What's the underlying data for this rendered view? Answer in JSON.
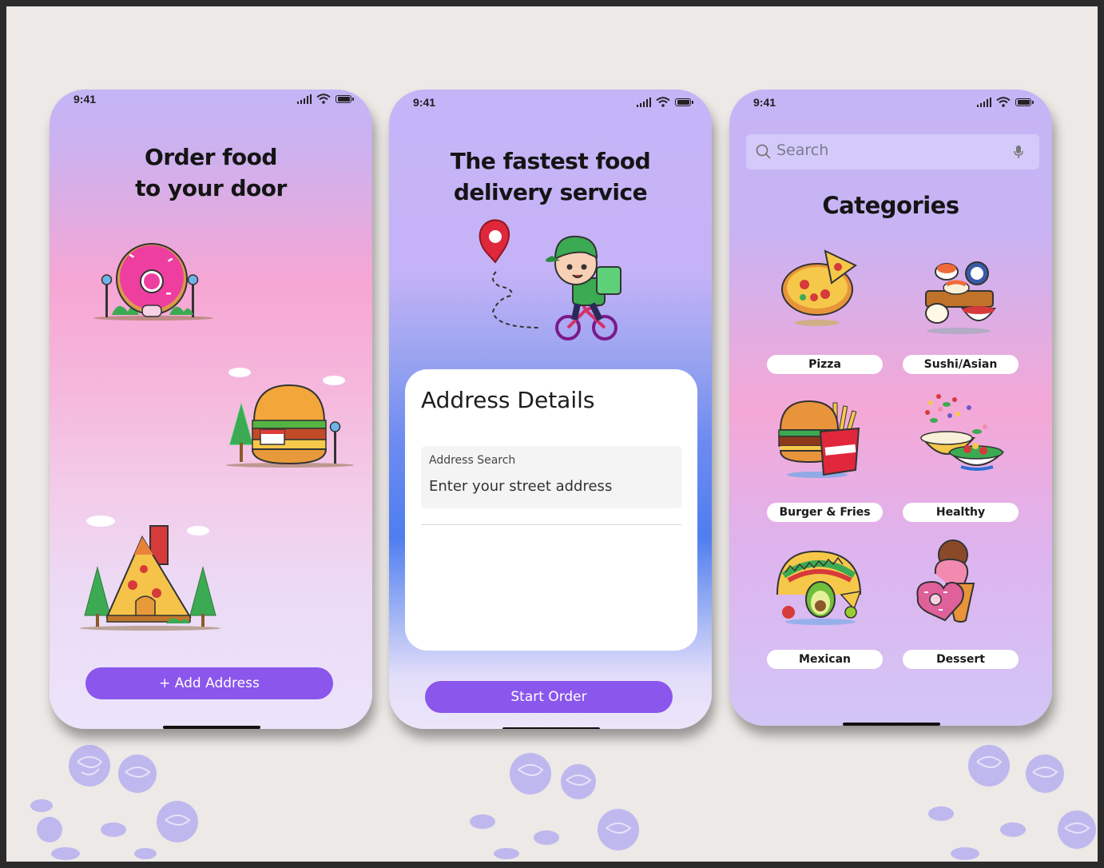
{
  "screens": {
    "onboarding": {
      "time": "9:41",
      "headline_line1": "Order food",
      "headline_line2": "to your door",
      "add_address_label": "+ Add Address"
    },
    "address": {
      "time": "9:41",
      "headline_line1": "The fastest food",
      "headline_line2": "delivery service",
      "card_title": "Address Details",
      "field_label": "Address Search",
      "field_placeholder": "Enter your street address",
      "start_order_label": "Start Order"
    },
    "categories": {
      "time": "9:41",
      "search_placeholder": "Search",
      "title": "Categories",
      "items": [
        {
          "label": "Pizza",
          "icon": "pizza-icon"
        },
        {
          "label": "Sushi/Asian",
          "icon": "sushi-icon"
        },
        {
          "label": "Burger & Fries",
          "icon": "burger-fries-icon"
        },
        {
          "label": "Healthy",
          "icon": "salad-icon"
        },
        {
          "label": "Mexican",
          "icon": "taco-icon"
        },
        {
          "label": "Dessert",
          "icon": "ice-cream-donut-icon"
        }
      ]
    }
  },
  "colors": {
    "accent": "#8a56ec",
    "background": "#ece9e6",
    "gradient_top": "#c4b5f6",
    "gradient_pink": "#f6a6d4",
    "gradient_blue": "#4f7ef0"
  }
}
